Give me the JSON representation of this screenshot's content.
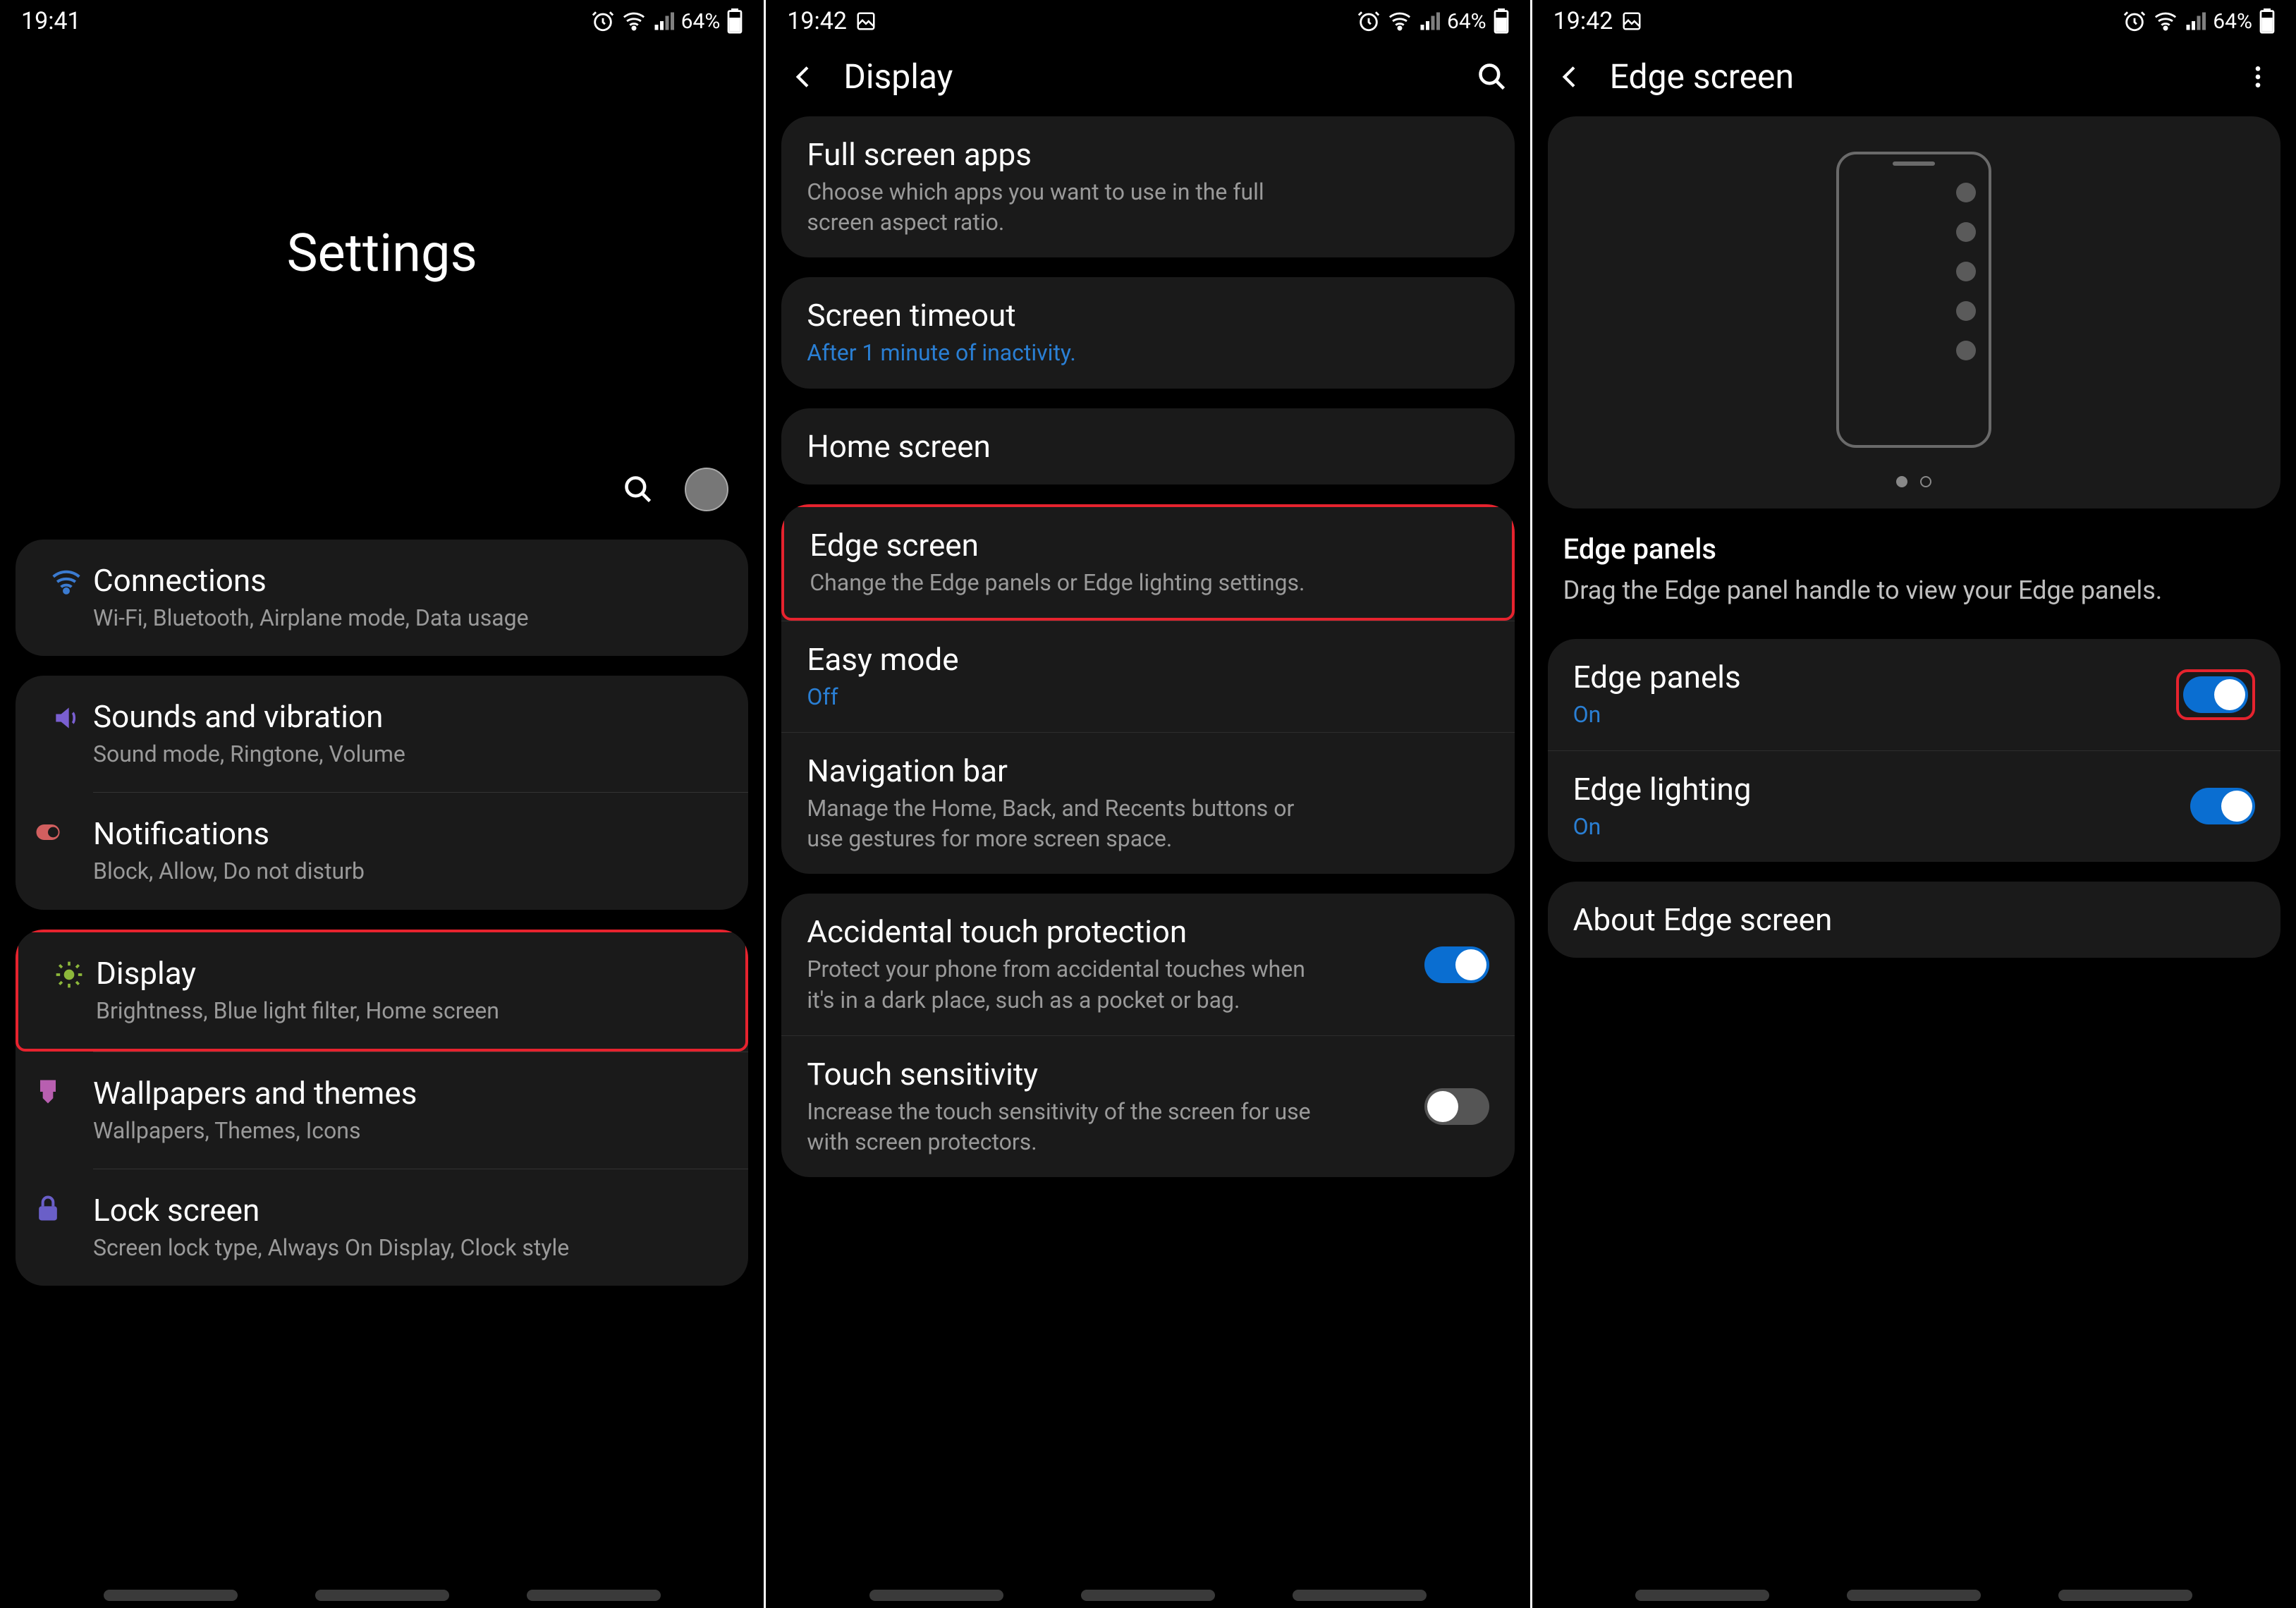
{
  "status": {
    "time1": "19:41",
    "time2": "19:42",
    "battery": "64%"
  },
  "screen1": {
    "title": "Settings",
    "groups": [
      {
        "items": [
          {
            "icon": "wifi",
            "color": "#3b7bd1",
            "title": "Connections",
            "sub": "Wi-Fi, Bluetooth, Airplane mode, Data usage",
            "highlight": false
          }
        ]
      },
      {
        "items": [
          {
            "icon": "sound",
            "color": "#7a5fd1",
            "title": "Sounds and vibration",
            "sub": "Sound mode, Ringtone, Volume",
            "highlight": false
          },
          {
            "icon": "dnd",
            "color": "#d15f5f",
            "title": "Notifications",
            "sub": "Block, Allow, Do not disturb",
            "highlight": false
          }
        ]
      },
      {
        "items": [
          {
            "icon": "brightness",
            "color": "#8db83b",
            "title": "Display",
            "sub": "Brightness, Blue light filter, Home screen",
            "highlight": true
          },
          {
            "icon": "brush",
            "color": "#b85fb0",
            "title": "Wallpapers and themes",
            "sub": "Wallpapers, Themes, Icons",
            "highlight": false
          },
          {
            "icon": "lock",
            "color": "#6a5fc8",
            "title": "Lock screen",
            "sub": "Screen lock type, Always On Display, Clock style",
            "highlight": false
          }
        ]
      }
    ]
  },
  "screen2": {
    "title": "Display",
    "groups": [
      {
        "items": [
          {
            "title": "Full screen apps",
            "sub": "Choose which apps you want to use in the full screen aspect ratio.",
            "blue": false,
            "highlight": false
          }
        ]
      },
      {
        "items": [
          {
            "title": "Screen timeout",
            "sub": "After 1 minute of inactivity.",
            "blue": true,
            "highlight": false
          }
        ]
      },
      {
        "items": [
          {
            "title": "Home screen",
            "sub": "",
            "blue": false,
            "highlight": false
          }
        ]
      },
      {
        "items": [
          {
            "title": "Edge screen",
            "sub": "Change the Edge panels or Edge lighting settings.",
            "blue": false,
            "highlight": true
          },
          {
            "title": "Easy mode",
            "sub": "Off",
            "blue": true,
            "highlight": false
          },
          {
            "title": "Navigation bar",
            "sub": "Manage the Home, Back, and Recents buttons or use gestures for more screen space.",
            "blue": false,
            "highlight": false
          }
        ]
      },
      {
        "items": [
          {
            "title": "Accidental touch protection",
            "sub": "Protect your phone from accidental touches when it's in a dark place, such as a pocket or bag.",
            "blue": false,
            "toggle": "on",
            "highlight": false
          },
          {
            "title": "Touch sensitivity",
            "sub": "Increase the touch sensitivity of the screen for use with screen protectors.",
            "blue": false,
            "toggle": "off",
            "highlight": false
          }
        ]
      }
    ]
  },
  "screen3": {
    "title": "Edge screen",
    "header": {
      "title": "Edge panels",
      "desc": "Drag the Edge panel handle to view your Edge panels."
    },
    "groups": [
      {
        "items": [
          {
            "title": "Edge panels",
            "sub": "On",
            "blue": true,
            "toggle": "on",
            "toggle_highlight": true
          },
          {
            "title": "Edge lighting",
            "sub": "On",
            "blue": true,
            "toggle": "on",
            "toggle_highlight": false
          }
        ]
      },
      {
        "items": [
          {
            "title": "About Edge screen",
            "sub": "",
            "blue": false
          }
        ]
      }
    ]
  }
}
